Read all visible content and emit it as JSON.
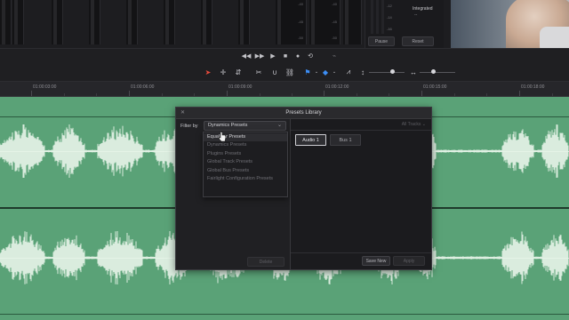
{
  "meters": {
    "scale_labels": [
      "-40",
      "-45",
      "-50"
    ],
    "lufs_labels": [
      "-12",
      "-14",
      "-16"
    ],
    "integrated_label": "Integrated",
    "integrated_value": "--",
    "pause_label": "Pause",
    "reset_label": "Reset"
  },
  "ruler": {
    "timecodes": [
      "01:00:03:00",
      "01:00:06:00",
      "01:00:09:00",
      "01:00:12:00",
      "01:00:15:00",
      "01:00:18:00"
    ]
  },
  "dialog": {
    "title": "Presets Library",
    "filter_label": "Filter by",
    "filter_value": "Dynamics Presets",
    "filter_options": [
      "Equalizer Presets",
      "Dynamics Presets",
      "Plugins Presets",
      "Global Track Presets",
      "Global Bus Presets",
      "Fairlight Configuration Presets"
    ],
    "all_tracks_label": "All Tracks",
    "tracks": [
      "Audio 1",
      "Bus 1"
    ],
    "delete_label": "Delete",
    "save_new_label": "Save New",
    "apply_label": "Apply"
  },
  "colors": {
    "track_green": "#5aa277",
    "waveform": "#e8f5ea",
    "accent_red": "#e84a3c",
    "accent_blue": "#3d8ef5"
  }
}
